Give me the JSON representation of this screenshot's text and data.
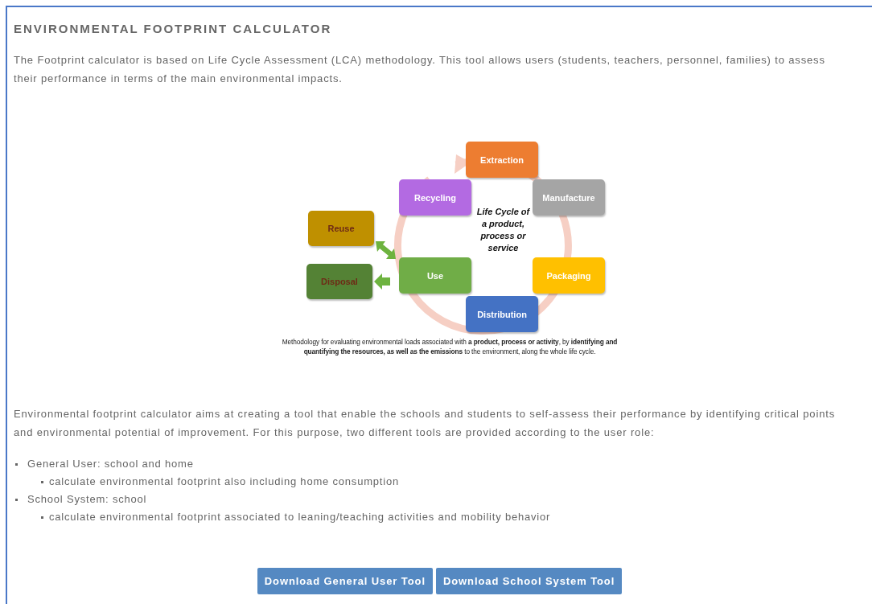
{
  "title": "ENVIRONMENTAL FOOTPRINT CALCULATOR",
  "intro": "The Footprint calculator is based on Life Cycle Assessment (LCA) methodology. This tool allows users (students, teachers, personnel, families) to assess their performance in terms of the main environmental impacts.",
  "diagram": {
    "center_label": "Life Cycle of a product, process or service",
    "stages": [
      {
        "label": "Extraction",
        "color": "#ed7d31",
        "kind": "cycle"
      },
      {
        "label": "Manufacture",
        "color": "#a5a5a5",
        "kind": "cycle"
      },
      {
        "label": "Recycling",
        "color": "#b36ae2",
        "kind": "cycle"
      },
      {
        "label": "Reuse",
        "color": "#bf9000",
        "kind": "side"
      },
      {
        "label": "Disposal",
        "color": "#548235",
        "kind": "side"
      },
      {
        "label": "Use",
        "color": "#70ad47",
        "kind": "cycle"
      },
      {
        "label": "Packaging",
        "color": "#ffc000",
        "kind": "cycle"
      },
      {
        "label": "Distribution",
        "color": "#4472c4",
        "kind": "cycle"
      }
    ],
    "caption": "Methodology for evaluating environmental loads associated with **a product, process or activity**, by **identifying and quantifying the resources, as well as the emissions** to the environment, along the whole life cycle."
  },
  "description": "Environmental footprint calculator aims at creating a tool that enable the schools and students to self-assess their performance by identifying critical points and environmental potential of improvement. For this purpose, two different tools are provided according to the user role:",
  "roles": [
    {
      "label": "General User: school and home",
      "children": [
        {
          "label": "calculate environmental footprint also including home consumption"
        }
      ]
    },
    {
      "label": "School System: school",
      "children": [
        {
          "label": "calculate environmental footprint associated to leaning/teaching activities and mobility behavior"
        }
      ]
    }
  ],
  "buttons": [
    "Download General User Tool",
    "Download School System Tool"
  ]
}
